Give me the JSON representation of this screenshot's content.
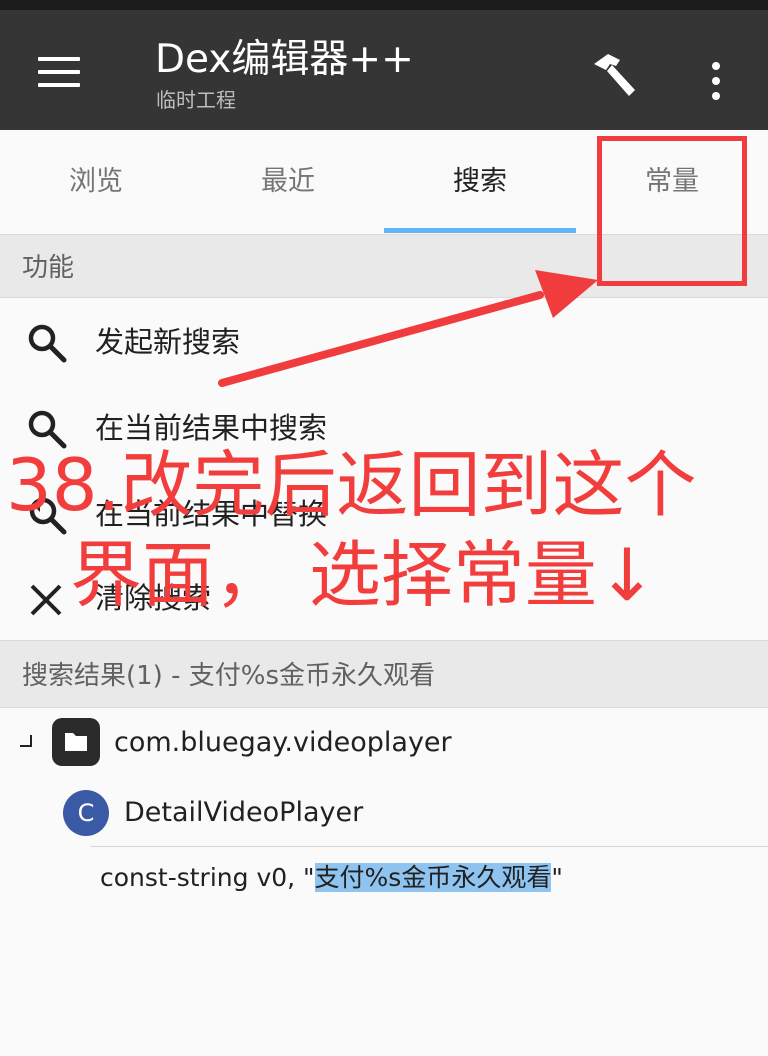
{
  "appbar": {
    "title": "Dex编辑器++",
    "subtitle": "临时工程",
    "menu_icon": "hamburger-menu-icon",
    "build_icon": "hammer-icon",
    "more_icon": "more-vert-icon"
  },
  "tabs": [
    {
      "label": "浏览",
      "active": false
    },
    {
      "label": "最近",
      "active": false
    },
    {
      "label": "搜索",
      "active": true
    },
    {
      "label": "常量",
      "active": false
    }
  ],
  "functions": {
    "header": "功能",
    "items": [
      {
        "label": "发起新搜索",
        "icon": "search-icon"
      },
      {
        "label": "在当前结果中搜索",
        "icon": "search-icon"
      },
      {
        "label": "在当前结果中替换",
        "icon": "find-replace-icon"
      },
      {
        "label": "清除搜索",
        "icon": "close-icon"
      }
    ]
  },
  "results": {
    "header": "搜索结果(1) - 支付%s金币永久观看",
    "package": "com.bluegay.videoplayer",
    "class_badge": "C",
    "class_name": "DetailVideoPlayer",
    "line_prefix": "const-string v0, \"",
    "line_match": "支付%s金币永久观看",
    "line_suffix": "\""
  },
  "annotation": {
    "line1": "38.改完后返回到这个",
    "line2": "界面， 选择常量↓",
    "color": "#f23d3d"
  },
  "colors": {
    "appbar": "#353535",
    "tab_indicator": "#64b5f6",
    "highlight": "#90c4f0",
    "class_icon": "#3b5aa6"
  }
}
